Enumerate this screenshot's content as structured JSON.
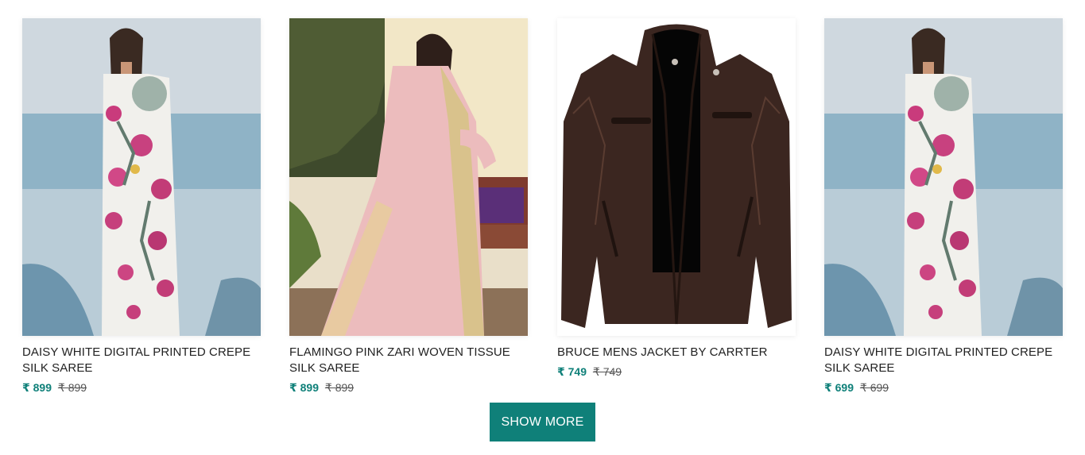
{
  "products": [
    {
      "title": "DAISY WHITE DIGITAL PRINTED CREPE SILK SAREE",
      "price": "₹ 899",
      "mrp": "₹ 899"
    },
    {
      "title": "FLAMINGO PINK ZARI WOVEN TISSUE SILK SAREE",
      "price": "₹ 899",
      "mrp": "₹ 899"
    },
    {
      "title": "BRUCE MENS JACKET BY CARRTER",
      "price": "₹ 749",
      "mrp": "₹ 749"
    },
    {
      "title": "DAISY WHITE DIGITAL PRINTED CREPE SILK SAREE",
      "price": "₹ 699",
      "mrp": "₹ 699"
    }
  ],
  "show_more": {
    "label": "SHOW MORE"
  },
  "colors": {
    "accent": "#0f8079"
  }
}
